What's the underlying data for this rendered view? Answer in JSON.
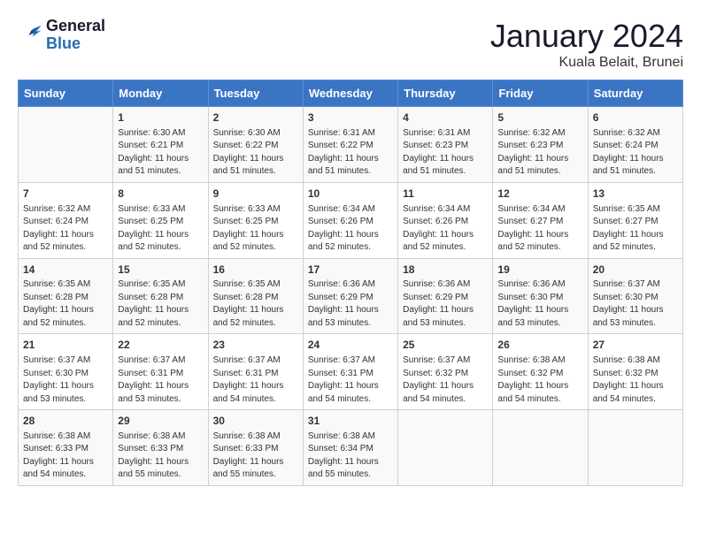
{
  "header": {
    "logo_line1": "General",
    "logo_line2": "Blue",
    "month": "January 2024",
    "location": "Kuala Belait, Brunei"
  },
  "weekdays": [
    "Sunday",
    "Monday",
    "Tuesday",
    "Wednesday",
    "Thursday",
    "Friday",
    "Saturday"
  ],
  "weeks": [
    [
      {
        "day": "",
        "info": ""
      },
      {
        "day": "1",
        "info": "Sunrise: 6:30 AM\nSunset: 6:21 PM\nDaylight: 11 hours\nand 51 minutes."
      },
      {
        "day": "2",
        "info": "Sunrise: 6:30 AM\nSunset: 6:22 PM\nDaylight: 11 hours\nand 51 minutes."
      },
      {
        "day": "3",
        "info": "Sunrise: 6:31 AM\nSunset: 6:22 PM\nDaylight: 11 hours\nand 51 minutes."
      },
      {
        "day": "4",
        "info": "Sunrise: 6:31 AM\nSunset: 6:23 PM\nDaylight: 11 hours\nand 51 minutes."
      },
      {
        "day": "5",
        "info": "Sunrise: 6:32 AM\nSunset: 6:23 PM\nDaylight: 11 hours\nand 51 minutes."
      },
      {
        "day": "6",
        "info": "Sunrise: 6:32 AM\nSunset: 6:24 PM\nDaylight: 11 hours\nand 51 minutes."
      }
    ],
    [
      {
        "day": "7",
        "info": "Sunrise: 6:32 AM\nSunset: 6:24 PM\nDaylight: 11 hours\nand 52 minutes."
      },
      {
        "day": "8",
        "info": "Sunrise: 6:33 AM\nSunset: 6:25 PM\nDaylight: 11 hours\nand 52 minutes."
      },
      {
        "day": "9",
        "info": "Sunrise: 6:33 AM\nSunset: 6:25 PM\nDaylight: 11 hours\nand 52 minutes."
      },
      {
        "day": "10",
        "info": "Sunrise: 6:34 AM\nSunset: 6:26 PM\nDaylight: 11 hours\nand 52 minutes."
      },
      {
        "day": "11",
        "info": "Sunrise: 6:34 AM\nSunset: 6:26 PM\nDaylight: 11 hours\nand 52 minutes."
      },
      {
        "day": "12",
        "info": "Sunrise: 6:34 AM\nSunset: 6:27 PM\nDaylight: 11 hours\nand 52 minutes."
      },
      {
        "day": "13",
        "info": "Sunrise: 6:35 AM\nSunset: 6:27 PM\nDaylight: 11 hours\nand 52 minutes."
      }
    ],
    [
      {
        "day": "14",
        "info": "Sunrise: 6:35 AM\nSunset: 6:28 PM\nDaylight: 11 hours\nand 52 minutes."
      },
      {
        "day": "15",
        "info": "Sunrise: 6:35 AM\nSunset: 6:28 PM\nDaylight: 11 hours\nand 52 minutes."
      },
      {
        "day": "16",
        "info": "Sunrise: 6:35 AM\nSunset: 6:28 PM\nDaylight: 11 hours\nand 52 minutes."
      },
      {
        "day": "17",
        "info": "Sunrise: 6:36 AM\nSunset: 6:29 PM\nDaylight: 11 hours\nand 53 minutes."
      },
      {
        "day": "18",
        "info": "Sunrise: 6:36 AM\nSunset: 6:29 PM\nDaylight: 11 hours\nand 53 minutes."
      },
      {
        "day": "19",
        "info": "Sunrise: 6:36 AM\nSunset: 6:30 PM\nDaylight: 11 hours\nand 53 minutes."
      },
      {
        "day": "20",
        "info": "Sunrise: 6:37 AM\nSunset: 6:30 PM\nDaylight: 11 hours\nand 53 minutes."
      }
    ],
    [
      {
        "day": "21",
        "info": "Sunrise: 6:37 AM\nSunset: 6:30 PM\nDaylight: 11 hours\nand 53 minutes."
      },
      {
        "day": "22",
        "info": "Sunrise: 6:37 AM\nSunset: 6:31 PM\nDaylight: 11 hours\nand 53 minutes."
      },
      {
        "day": "23",
        "info": "Sunrise: 6:37 AM\nSunset: 6:31 PM\nDaylight: 11 hours\nand 54 minutes."
      },
      {
        "day": "24",
        "info": "Sunrise: 6:37 AM\nSunset: 6:31 PM\nDaylight: 11 hours\nand 54 minutes."
      },
      {
        "day": "25",
        "info": "Sunrise: 6:37 AM\nSunset: 6:32 PM\nDaylight: 11 hours\nand 54 minutes."
      },
      {
        "day": "26",
        "info": "Sunrise: 6:38 AM\nSunset: 6:32 PM\nDaylight: 11 hours\nand 54 minutes."
      },
      {
        "day": "27",
        "info": "Sunrise: 6:38 AM\nSunset: 6:32 PM\nDaylight: 11 hours\nand 54 minutes."
      }
    ],
    [
      {
        "day": "28",
        "info": "Sunrise: 6:38 AM\nSunset: 6:33 PM\nDaylight: 11 hours\nand 54 minutes."
      },
      {
        "day": "29",
        "info": "Sunrise: 6:38 AM\nSunset: 6:33 PM\nDaylight: 11 hours\nand 55 minutes."
      },
      {
        "day": "30",
        "info": "Sunrise: 6:38 AM\nSunset: 6:33 PM\nDaylight: 11 hours\nand 55 minutes."
      },
      {
        "day": "31",
        "info": "Sunrise: 6:38 AM\nSunset: 6:34 PM\nDaylight: 11 hours\nand 55 minutes."
      },
      {
        "day": "",
        "info": ""
      },
      {
        "day": "",
        "info": ""
      },
      {
        "day": "",
        "info": ""
      }
    ]
  ]
}
